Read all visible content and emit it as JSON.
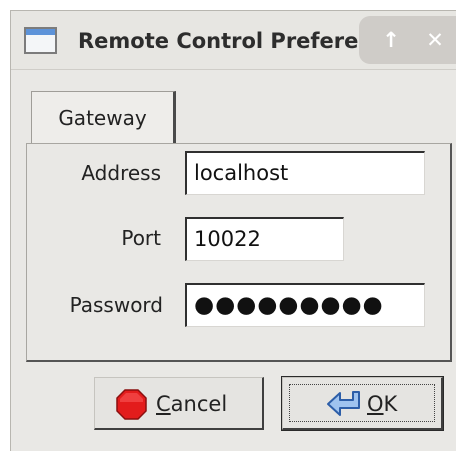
{
  "window": {
    "title": "Remote Control Preferences",
    "controls": {
      "maximize": "↑",
      "close": "✕"
    }
  },
  "tabs": [
    {
      "label": "Gateway",
      "selected": true
    }
  ],
  "form": {
    "address": {
      "label": "Address",
      "value": "localhost"
    },
    "port": {
      "label": "Port",
      "value": "10022"
    },
    "password": {
      "label": "Password",
      "value": "●●●●●●●●●"
    }
  },
  "buttons": {
    "cancel": {
      "mnemonic": "C",
      "rest": "ancel",
      "icon": "stop-icon"
    },
    "ok": {
      "mnemonic": "O",
      "rest": "K",
      "icon": "enter-arrow-icon"
    }
  },
  "colors": {
    "accent": "#5d93d9",
    "stop": "#e31c1c"
  }
}
